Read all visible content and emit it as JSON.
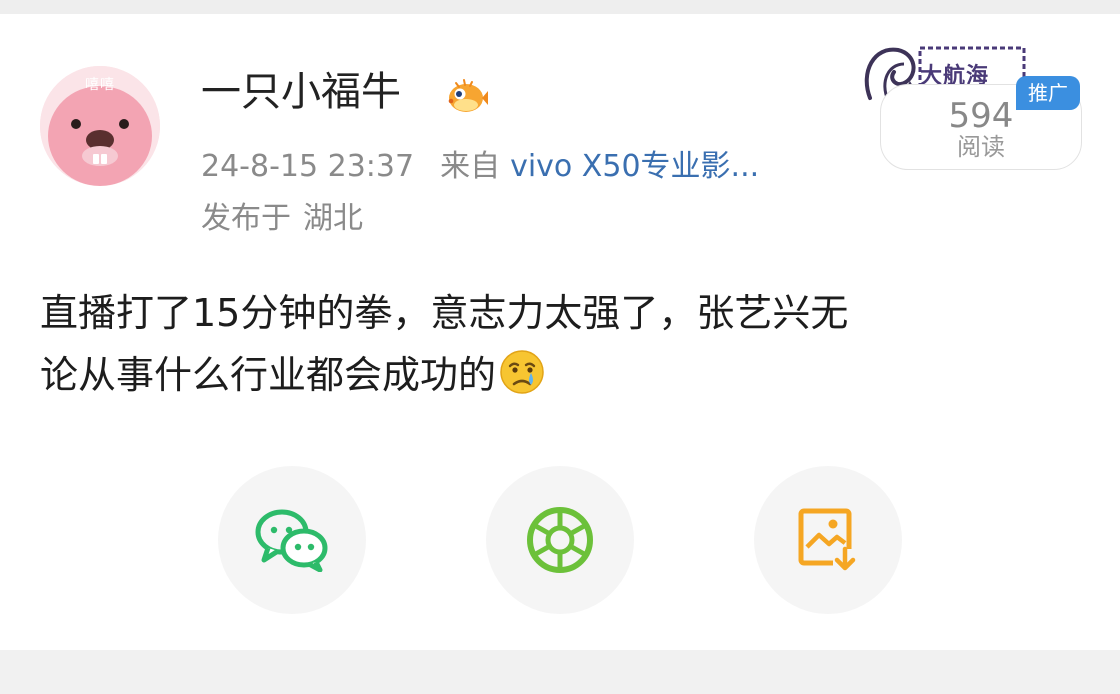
{
  "post": {
    "username": "一只小福牛",
    "avatar_tag": "嘻嘻",
    "time": "24-8-15 23:37",
    "source_prefix": "来自",
    "device": "vivo X50专业影...",
    "location_prefix": "发布于",
    "location": "湖北",
    "reads_count": "594",
    "reads_label": "阅读",
    "promo_badge": "推广",
    "stamp_text": "大航海",
    "text_line1": "直播打了15分钟的拳，意志力太强了，张艺兴无",
    "text_line2": "论从事什么行业都会成功的"
  },
  "icons": {
    "vip": "pufferfish-badge-icon",
    "emoji": "crying-face-emoji",
    "share": [
      "wechat-icon",
      "moments-icon",
      "save-image-icon"
    ]
  },
  "colors": {
    "wechat": "#2dbb6a",
    "moments": "#6cc13a",
    "save": "#f5a623",
    "device_link": "#3a6fb0",
    "badge": "#3b8fe0"
  }
}
